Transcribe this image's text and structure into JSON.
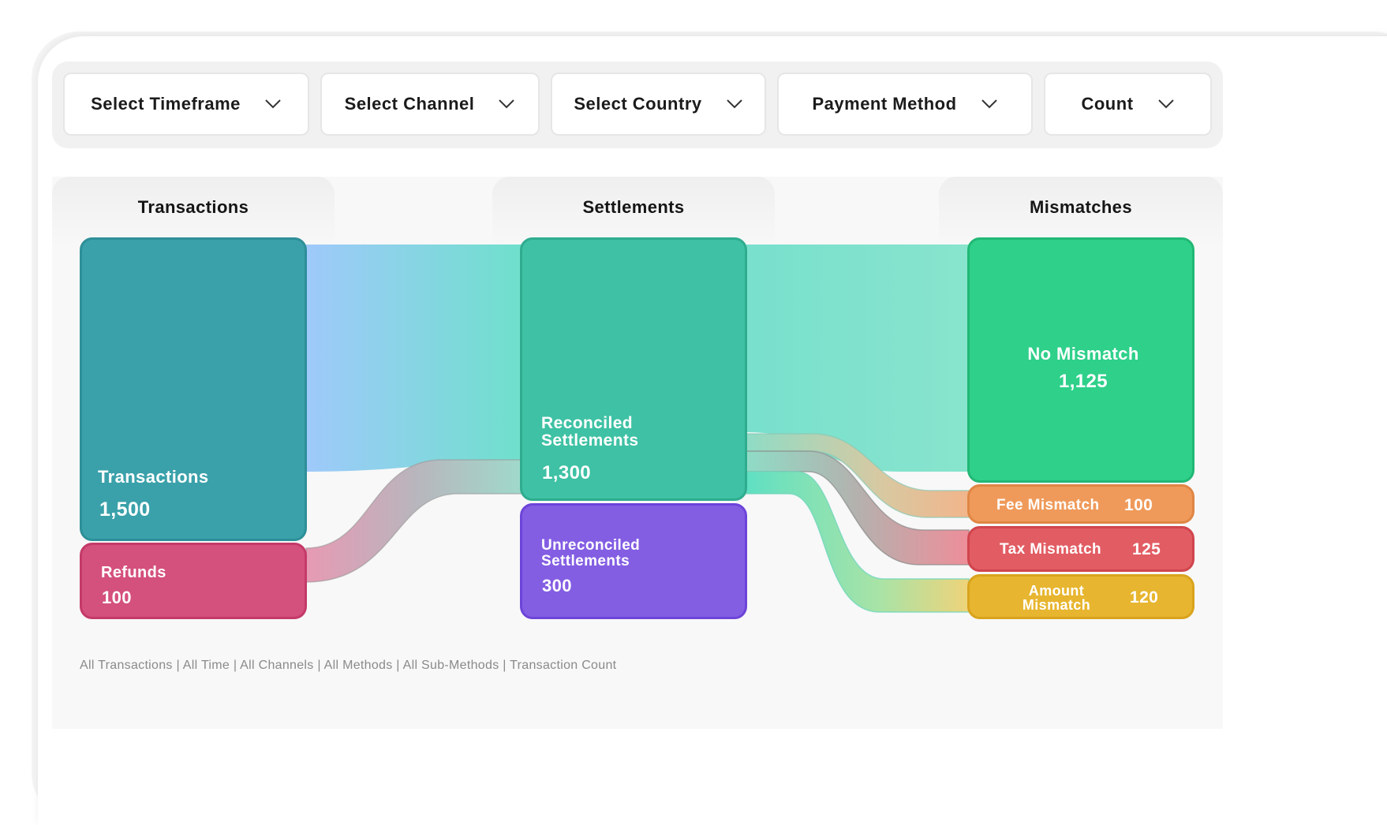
{
  "filters": [
    {
      "label": "Select Timeframe"
    },
    {
      "label": "Select Channel"
    },
    {
      "label": "Select Country"
    },
    {
      "label": "Payment Method"
    },
    {
      "label": "Count"
    }
  ],
  "columns": [
    "Transactions",
    "Settlements",
    "Mismatches"
  ],
  "colors": {
    "transactions": "#3aa1aa",
    "refunds": "#d4507d",
    "reconciled": "#3ec1a4",
    "unreconciled": "#835ee3",
    "no_mismatch": "#2ed08a",
    "fee_mismatch": "#ef9a5a",
    "tax_mismatch": "#e25c63",
    "amount_mismatch": "#e7b52f"
  },
  "chart_data": {
    "type": "sankey",
    "nodes": [
      {
        "id": "transactions",
        "label": "Transactions",
        "value": "1,500",
        "column": "Transactions"
      },
      {
        "id": "refunds",
        "label": "Refunds",
        "value": "100",
        "column": "Transactions"
      },
      {
        "id": "reconciled",
        "label": "Reconciled Settlements",
        "value": "1,300",
        "column": "Settlements"
      },
      {
        "id": "unreconciled",
        "label": "Unreconciled Settlements",
        "value": "300",
        "column": "Settlements"
      },
      {
        "id": "no_mismatch",
        "label": "No Mismatch",
        "value": "1,125",
        "column": "Mismatches"
      },
      {
        "id": "fee_mismatch",
        "label": "Fee Mismatch",
        "value": "100",
        "column": "Mismatches"
      },
      {
        "id": "tax_mismatch",
        "label": "Tax Mismatch",
        "value": "125",
        "column": "Mismatches"
      },
      {
        "id": "amount_mismatch",
        "label": "Amount Mismatch",
        "value": "120",
        "column": "Mismatches"
      }
    ],
    "links": [
      {
        "source": "transactions",
        "target": "reconciled"
      },
      {
        "source": "refunds",
        "target": "reconciled"
      },
      {
        "source": "reconciled",
        "target": "no_mismatch"
      },
      {
        "source": "reconciled",
        "target": "fee_mismatch"
      },
      {
        "source": "reconciled",
        "target": "tax_mismatch"
      },
      {
        "source": "reconciled",
        "target": "amount_mismatch"
      }
    ]
  },
  "footer": "All Transactions | All Time | All Channels | All Methods | All Sub-Methods | Transaction Count"
}
